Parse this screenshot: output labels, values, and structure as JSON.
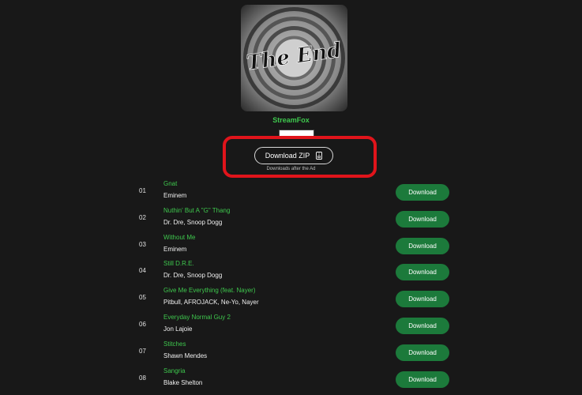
{
  "album": {
    "cover_text": "The End",
    "title": "StreamFox"
  },
  "zip": {
    "label": "Download ZIP",
    "icon": "zip-file-icon",
    "note": "Downloads after the Ad"
  },
  "colors": {
    "accent_green": "#3ec74d",
    "button_green": "#1c7a3b",
    "highlight_red": "#e0141b",
    "background": "#181818"
  },
  "tracks": [
    {
      "num": "01",
      "title": "Gnat",
      "artist": "Eminem",
      "button": "Download"
    },
    {
      "num": "02",
      "title": "Nuthin' But A \"G\" Thang",
      "artist": "Dr. Dre, Snoop Dogg",
      "button": "Download"
    },
    {
      "num": "03",
      "title": "Without Me",
      "artist": "Eminem",
      "button": "Download"
    },
    {
      "num": "04",
      "title": "Still D.R.E.",
      "artist": "Dr. Dre, Snoop Dogg",
      "button": "Download"
    },
    {
      "num": "05",
      "title": "Give Me Everything (feat. Nayer)",
      "artist": "Pitbull, AFROJACK, Ne-Yo, Nayer",
      "button": "Download"
    },
    {
      "num": "06",
      "title": "Everyday Normal Guy 2",
      "artist": "Jon Lajoie",
      "button": "Download"
    },
    {
      "num": "07",
      "title": "Stitches",
      "artist": "Shawn Mendes",
      "button": "Download"
    },
    {
      "num": "08",
      "title": "Sangria",
      "artist": "Blake Shelton",
      "button": "Download"
    }
  ]
}
